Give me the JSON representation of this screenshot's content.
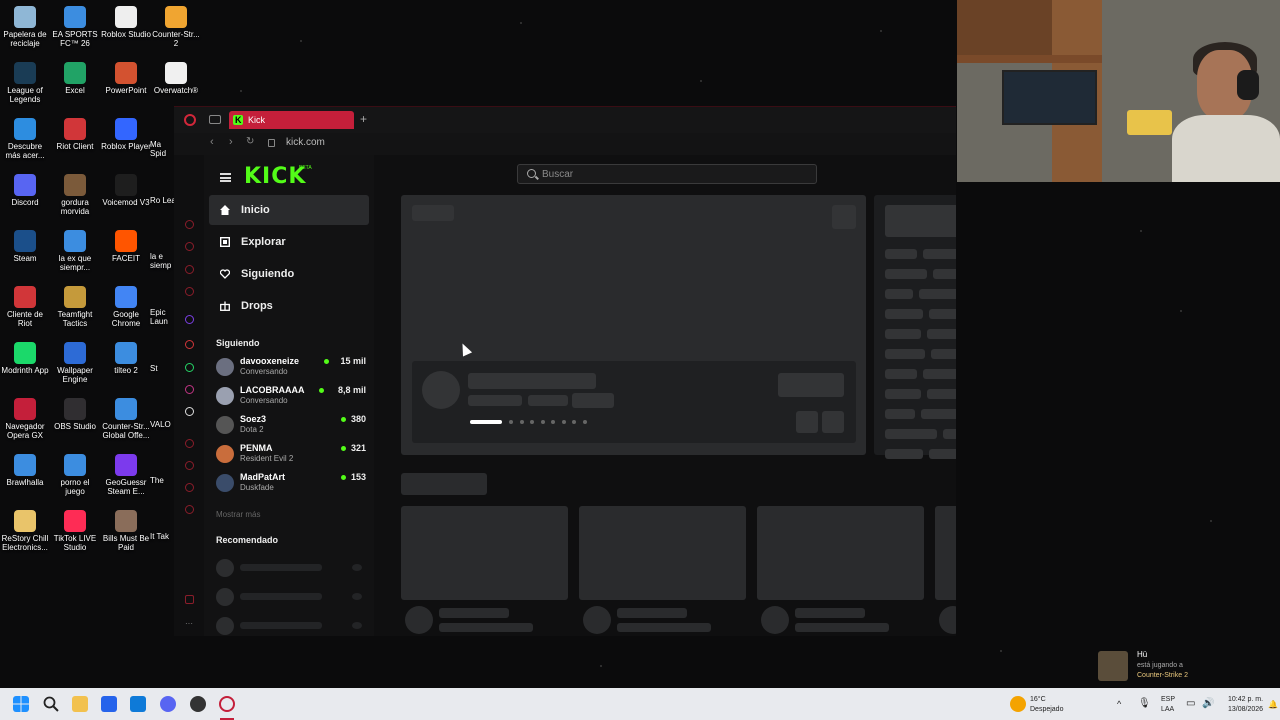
{
  "desktop": {
    "icons": [
      {
        "label": "Papelera de reciclaje",
        "color": "#8fb7d6"
      },
      {
        "label": "EA SPORTS FC™ 26",
        "color": "#3c8de0"
      },
      {
        "label": "Roblox Studio",
        "color": "#eeeeee"
      },
      {
        "label": "Counter-Str... 2",
        "color": "#f0a531"
      },
      {
        "label": "League of Legends",
        "color": "#1a3c55"
      },
      {
        "label": "Excel",
        "color": "#21a366"
      },
      {
        "label": "PowerPoint",
        "color": "#d35230"
      },
      {
        "label": "Overwatch®",
        "color": "#f0f0f0"
      },
      {
        "label": "Descubre más acer...",
        "color": "#2d8de0"
      },
      {
        "label": "Riot Client",
        "color": "#d13639"
      },
      {
        "label": "Roblox Player",
        "color": "#3366ff"
      },
      {
        "label": "Discord",
        "color": "#5865f2"
      },
      {
        "label": "gordura morvida",
        "color": "#7b5a3a"
      },
      {
        "label": "Voicemod V3",
        "color": "#1e1e1e"
      },
      {
        "label": "Steam",
        "color": "#1b4f8a"
      },
      {
        "label": "la ex que siempr...",
        "color": "#3c8de0"
      },
      {
        "label": "FACEIT",
        "color": "#ff5500"
      },
      {
        "label": "Cliente de Riot",
        "color": "#d13639"
      },
      {
        "label": "Teamfight Tactics",
        "color": "#c59a3b"
      },
      {
        "label": "Google Chrome",
        "color": "#4285f4"
      },
      {
        "label": "Modrinth App",
        "color": "#1bd96a"
      },
      {
        "label": "Wallpaper Engine",
        "color": "#2d6bd6"
      },
      {
        "label": "tilteo 2",
        "color": "#3c8de0"
      },
      {
        "label": "Navegador Opera GX",
        "color": "#c41f3a"
      },
      {
        "label": "OBS Studio",
        "color": "#302e31"
      },
      {
        "label": "Counter-Str... Global Offe...",
        "color": "#3c8de0"
      },
      {
        "label": "Brawlhalla",
        "color": "#3c8de0"
      },
      {
        "label": "porno el juego",
        "color": "#3c8de0"
      },
      {
        "label": "GeoGuessr Steam E...",
        "color": "#7c3aed"
      },
      {
        "label": "ReStory Chill Electronics...",
        "color": "#e9c46a"
      },
      {
        "label": "TikTok LIVE Studio",
        "color": "#fe2c55"
      },
      {
        "label": "Bills Must Be Paid",
        "color": "#8a6d5a"
      }
    ],
    "partial_labels": [
      "Ma Spid",
      "Ro Lea",
      "la e siemp",
      "Epic Laun",
      "St",
      "VALO",
      "The",
      "It Tak"
    ]
  },
  "browser": {
    "tab_title": "Kick",
    "new_tab": "+",
    "url": "kick.com",
    "logo": "KICK",
    "logo_badge": "BETA",
    "search_placeholder": "Buscar",
    "nav": [
      {
        "label": "Inicio"
      },
      {
        "label": "Explorar"
      },
      {
        "label": "Siguiendo"
      },
      {
        "label": "Drops"
      }
    ],
    "following_title": "Siguiendo",
    "following": [
      {
        "name": "davooxeneize",
        "game": "Conversando",
        "viewers": "15 mil",
        "avatar_color": "#6b6f80"
      },
      {
        "name": "LACOBRAAAA",
        "game": "Conversando",
        "viewers": "8,8 mil",
        "avatar_color": "#9aa0b0"
      },
      {
        "name": "Soez3",
        "game": "Dota 2",
        "viewers": "380",
        "avatar_color": "#555"
      },
      {
        "name": "PENMA",
        "game": "Resident Evil 2",
        "viewers": "321",
        "avatar_color": "#c96d3c"
      },
      {
        "name": "MadPatArt",
        "game": "Duskfade",
        "viewers": "153",
        "avatar_color": "#3a4c6a"
      }
    ],
    "show_more": "Mostrar más",
    "recommended_title": "Recomendado"
  },
  "notification": {
    "name": "Hü",
    "line2": "está jugando a",
    "game": "Counter-Strike 2"
  },
  "taskbar": {
    "weather_temp": "16°C",
    "weather_desc": "Despejado",
    "lang1": "ESP",
    "lang2": "LAA",
    "time": "10:42 p. m.",
    "date": "13/08/2026",
    "tray_chevron": "^"
  },
  "colors": {
    "kick_green": "#53fc18",
    "opera_red": "#c41f3a",
    "skeleton": "#2c2d2f"
  }
}
